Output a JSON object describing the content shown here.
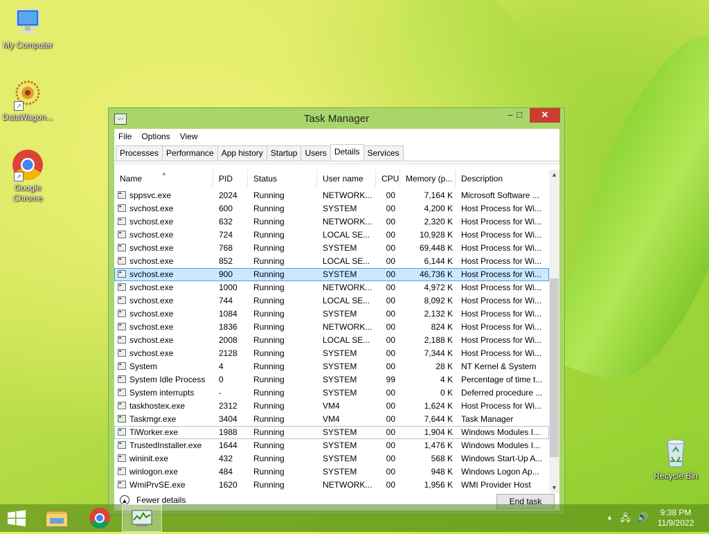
{
  "desktop": {
    "icons": [
      {
        "label": "My Computer"
      },
      {
        "label": "DataWagon..."
      },
      {
        "label": "Google Chrome"
      },
      {
        "label": "Recycle Bin"
      }
    ]
  },
  "window": {
    "title": "Task Manager",
    "controls": {
      "minimize": "–",
      "maximize": "□",
      "close": "✕"
    },
    "menu": [
      "File",
      "Options",
      "View"
    ],
    "tabs": [
      "Processes",
      "Performance",
      "App history",
      "Startup",
      "Users",
      "Details",
      "Services"
    ],
    "active_tab": "Details",
    "columns": [
      "Name",
      "PID",
      "Status",
      "User name",
      "CPU",
      "Memory (p...",
      "Description"
    ],
    "rows": [
      {
        "name": "sppsvc.exe",
        "pid": "2024",
        "status": "Running",
        "user": "NETWORK...",
        "cpu": "00",
        "mem": "7,164 K",
        "desc": "Microsoft Software ..."
      },
      {
        "name": "svchost.exe",
        "pid": "600",
        "status": "Running",
        "user": "SYSTEM",
        "cpu": "00",
        "mem": "4,200 K",
        "desc": "Host Process for Wi..."
      },
      {
        "name": "svchost.exe",
        "pid": "632",
        "status": "Running",
        "user": "NETWORK...",
        "cpu": "00",
        "mem": "2,320 K",
        "desc": "Host Process for Wi..."
      },
      {
        "name": "svchost.exe",
        "pid": "724",
        "status": "Running",
        "user": "LOCAL SE...",
        "cpu": "00",
        "mem": "10,928 K",
        "desc": "Host Process for Wi..."
      },
      {
        "name": "svchost.exe",
        "pid": "768",
        "status": "Running",
        "user": "SYSTEM",
        "cpu": "00",
        "mem": "69,448 K",
        "desc": "Host Process for Wi..."
      },
      {
        "name": "svchost.exe",
        "pid": "852",
        "status": "Running",
        "user": "LOCAL SE...",
        "cpu": "00",
        "mem": "6,144 K",
        "desc": "Host Process for Wi..."
      },
      {
        "name": "svchost.exe",
        "pid": "900",
        "status": "Running",
        "user": "SYSTEM",
        "cpu": "00",
        "mem": "46,736 K",
        "desc": "Host Process for Wi..."
      },
      {
        "name": "svchost.exe",
        "pid": "1000",
        "status": "Running",
        "user": "NETWORK...",
        "cpu": "00",
        "mem": "4,972 K",
        "desc": "Host Process for Wi..."
      },
      {
        "name": "svchost.exe",
        "pid": "744",
        "status": "Running",
        "user": "LOCAL SE...",
        "cpu": "00",
        "mem": "8,092 K",
        "desc": "Host Process for Wi..."
      },
      {
        "name": "svchost.exe",
        "pid": "1084",
        "status": "Running",
        "user": "SYSTEM",
        "cpu": "00",
        "mem": "2,132 K",
        "desc": "Host Process for Wi..."
      },
      {
        "name": "svchost.exe",
        "pid": "1836",
        "status": "Running",
        "user": "NETWORK...",
        "cpu": "00",
        "mem": "824 K",
        "desc": "Host Process for Wi..."
      },
      {
        "name": "svchost.exe",
        "pid": "2008",
        "status": "Running",
        "user": "LOCAL SE...",
        "cpu": "00",
        "mem": "2,188 K",
        "desc": "Host Process for Wi..."
      },
      {
        "name": "svchost.exe",
        "pid": "2128",
        "status": "Running",
        "user": "SYSTEM",
        "cpu": "00",
        "mem": "7,344 K",
        "desc": "Host Process for Wi..."
      },
      {
        "name": "System",
        "pid": "4",
        "status": "Running",
        "user": "SYSTEM",
        "cpu": "00",
        "mem": "28 K",
        "desc": "NT Kernel & System"
      },
      {
        "name": "System Idle Process",
        "pid": "0",
        "status": "Running",
        "user": "SYSTEM",
        "cpu": "99",
        "mem": "4 K",
        "desc": "Percentage of time t..."
      },
      {
        "name": "System interrupts",
        "pid": "-",
        "status": "Running",
        "user": "SYSTEM",
        "cpu": "00",
        "mem": "0 K",
        "desc": "Deferred procedure ..."
      },
      {
        "name": "taskhostex.exe",
        "pid": "2312",
        "status": "Running",
        "user": "VM4",
        "cpu": "00",
        "mem": "1,624 K",
        "desc": "Host Process for Wi..."
      },
      {
        "name": "Taskmgr.exe",
        "pid": "3404",
        "status": "Running",
        "user": "VM4",
        "cpu": "00",
        "mem": "7,644 K",
        "desc": "Task Manager"
      },
      {
        "name": "TiWorker.exe",
        "pid": "1988",
        "status": "Running",
        "user": "SYSTEM",
        "cpu": "00",
        "mem": "1,904 K",
        "desc": "Windows Modules I..."
      },
      {
        "name": "TrustedInstaller.exe",
        "pid": "1644",
        "status": "Running",
        "user": "SYSTEM",
        "cpu": "00",
        "mem": "1,476 K",
        "desc": "Windows Modules I..."
      },
      {
        "name": "wininit.exe",
        "pid": "432",
        "status": "Running",
        "user": "SYSTEM",
        "cpu": "00",
        "mem": "568 K",
        "desc": "Windows Start-Up A..."
      },
      {
        "name": "winlogon.exe",
        "pid": "484",
        "status": "Running",
        "user": "SYSTEM",
        "cpu": "00",
        "mem": "948 K",
        "desc": "Windows Logon Ap..."
      },
      {
        "name": "WmiPrvSE.exe",
        "pid": "1620",
        "status": "Running",
        "user": "NETWORK...",
        "cpu": "00",
        "mem": "1,956 K",
        "desc": "WMI Provider Host"
      }
    ],
    "selected_pid": "900",
    "hover_pid": "1988",
    "footer": {
      "fewer_details": "Fewer details",
      "end_task": "End task"
    }
  },
  "taskbar": {
    "items": [
      "start-button",
      "file-explorer",
      "google-chrome",
      "task-manager"
    ],
    "clock": {
      "time": "9:38 PM",
      "date": "11/9/2022"
    }
  }
}
